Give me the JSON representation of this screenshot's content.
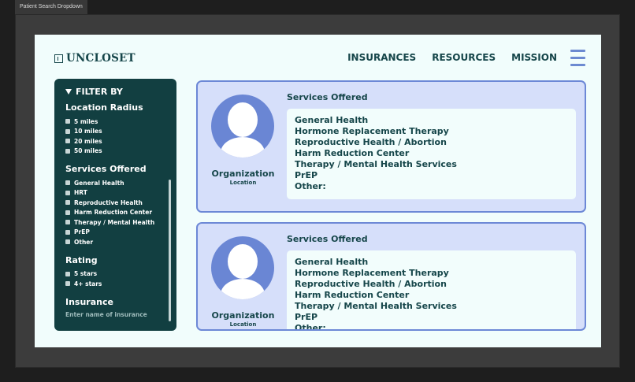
{
  "frame": {
    "tab_label": "Patient Search Dropdown"
  },
  "header": {
    "logo_text": "UNCLOSET",
    "nav": [
      "INSURANCES",
      "RESOURCES",
      "MISSION"
    ]
  },
  "sidebar": {
    "filter_title": "FILTER BY",
    "location": {
      "title": "Location Radius",
      "options": [
        "5 miles",
        "10 miles",
        "20 miles",
        "50 miles"
      ]
    },
    "services": {
      "title": "Services Offered",
      "options": [
        "General Health",
        "HRT",
        "Reproductive Health",
        "Harm Reduction Center",
        "Therapy / Mental Health",
        "PrEP",
        "Other"
      ]
    },
    "rating": {
      "title": "Rating",
      "options": [
        "5 stars",
        "4+ stars"
      ]
    },
    "insurance": {
      "title": "Insurance",
      "placeholder": "Enter name of insurance"
    }
  },
  "cards": [
    {
      "org_name": "Organization",
      "org_location": "Location",
      "services_title": "Services Offered",
      "services": [
        "General Health",
        "Hormone Replacement Therapy",
        "Reproductive Health / Abortion",
        "Harm Reduction Center",
        "Therapy / Mental Health Services",
        "PrEP",
        "Other:"
      ]
    },
    {
      "org_name": "Organization",
      "org_location": "Location",
      "services_title": "Services Offered",
      "services": [
        "General Health",
        "Hormone Replacement Therapy",
        "Reproductive Health / Abortion",
        "Harm Reduction Center",
        "Therapy / Mental Health Services",
        "PrEP",
        "Other:"
      ]
    }
  ],
  "colors": {
    "brand_dark": "#123f41",
    "accent": "#6c88d6",
    "card_bg": "#d6dffa",
    "page_bg": "#f1fdfc"
  }
}
